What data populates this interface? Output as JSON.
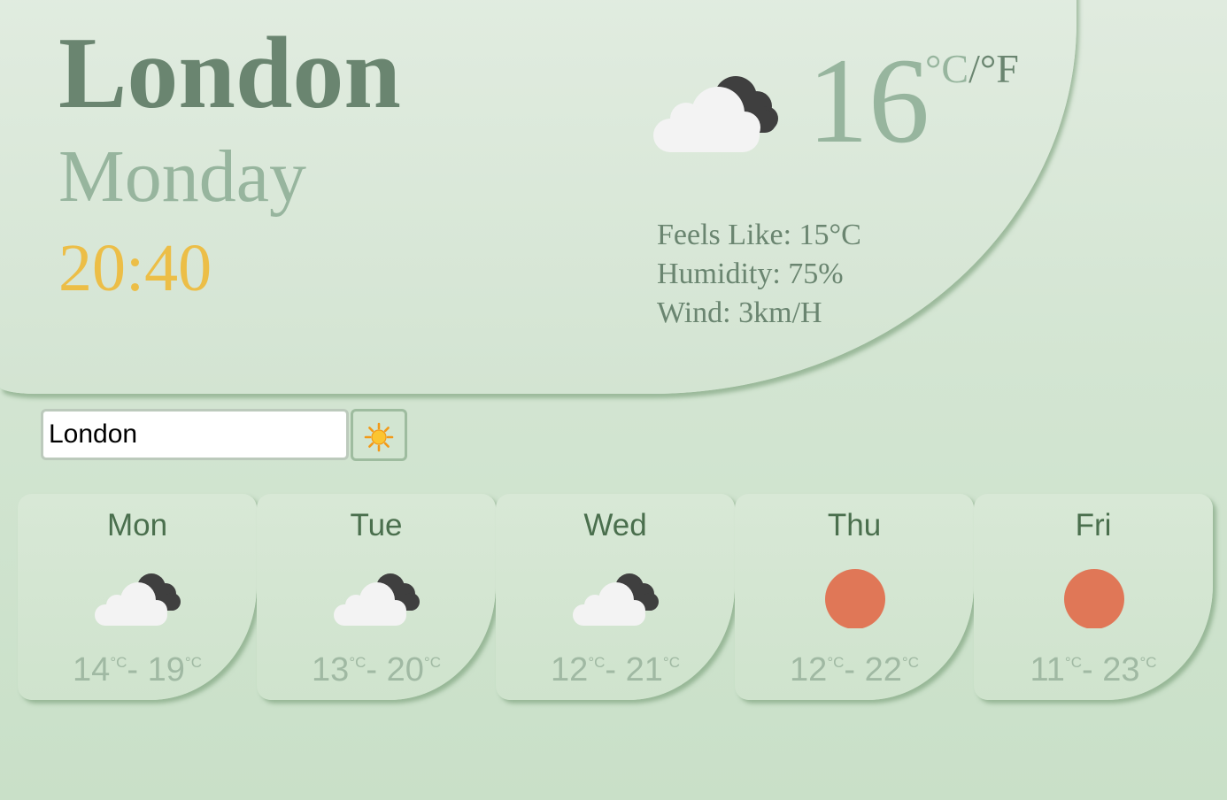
{
  "current": {
    "city": "London",
    "day": "Monday",
    "time": "20:40",
    "temperature": "16",
    "unit_celsius": "°C",
    "unit_separator": "/",
    "unit_fahrenheit": "°F",
    "icon": "cloud-icon",
    "feels_like": "Feels Like: 15°C",
    "humidity": "Humidity: 75%",
    "wind": "Wind: 3km/H"
  },
  "search": {
    "value": "London",
    "button_icon": "sun-icon"
  },
  "forecast": [
    {
      "day": "Mon",
      "icon": "cloud-icon",
      "min": "14",
      "max": "19",
      "unit": "°C",
      "dash": "- "
    },
    {
      "day": "Tue",
      "icon": "cloud-icon",
      "min": "13",
      "max": "20",
      "unit": "°C",
      "dash": "- "
    },
    {
      "day": "Wed",
      "icon": "cloud-icon",
      "min": "12",
      "max": "21",
      "unit": "°C",
      "dash": "- "
    },
    {
      "day": "Thu",
      "icon": "sun-icon",
      "min": "12",
      "max": "22",
      "unit": "°C",
      "dash": "- "
    },
    {
      "day": "Fri",
      "icon": "sun-icon",
      "min": "11",
      "max": "23",
      "unit": "°C",
      "dash": "- "
    }
  ],
  "colors": {
    "background": "#d3e5d2",
    "city": "#6a8570",
    "muted": "#97b59e",
    "time": "#ecbe47",
    "sun": "#e07757",
    "cloud_light": "#f3f3f3",
    "cloud_dark": "#3f3f3f"
  }
}
